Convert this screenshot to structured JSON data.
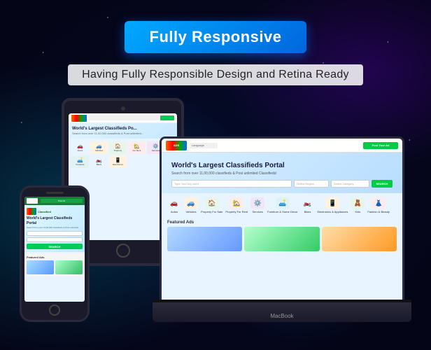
{
  "header": {
    "badge_text": "Fully Responsive",
    "subtitle": "Having Fully Responsible Design and Retina Ready"
  },
  "laptop": {
    "label": "MacBook",
    "screen": {
      "title": "World's Largest Classifieds Portal",
      "subtitle": "Search from over 11,00,000 classifieds & Post unlimited Classifieds!",
      "search_placeholder": "Type Your key word",
      "region_placeholder": "Select Region",
      "category_placeholder": "Select Category",
      "search_btn": "SEARCH",
      "featured_title": "Featured Ads",
      "categories": [
        {
          "label": "Autos",
          "color": "#e8f4ff"
        },
        {
          "label": "Vehicles",
          "color": "#fff3e0"
        },
        {
          "label": "Property For Sale",
          "color": "#e8f5e9"
        },
        {
          "label": "Property For Rent",
          "color": "#ffebee"
        },
        {
          "label": "Services",
          "color": "#f3e5f5"
        },
        {
          "label": "Furniture & Home Decor",
          "color": "#e0f2f1"
        },
        {
          "label": "Bikes",
          "color": "#e8f4ff"
        },
        {
          "label": "Electronics & Appliances",
          "color": "#fff3e0"
        },
        {
          "label": "Kids",
          "color": "#e8f5e9"
        },
        {
          "label": "Fashion & Beauty",
          "color": "#ffebee"
        }
      ]
    }
  },
  "tablet": {
    "screen": {
      "title": "World's Largest Classifieds Po...",
      "subtitle": "Search from over 11,00,000 classifieds & Post unlimited..."
    }
  },
  "phone": {
    "screen": {
      "title": "World's Largest Classifieds Portal",
      "subtitle": "Search from over 11,00,000 classifieds & Post unlimited",
      "search_btn": "SEARCH"
    }
  },
  "colors": {
    "badge_bg": "#0088ee",
    "badge_text": "#ffffff",
    "bg_dark": "#050518",
    "accent_cyan": "#00ccee"
  }
}
